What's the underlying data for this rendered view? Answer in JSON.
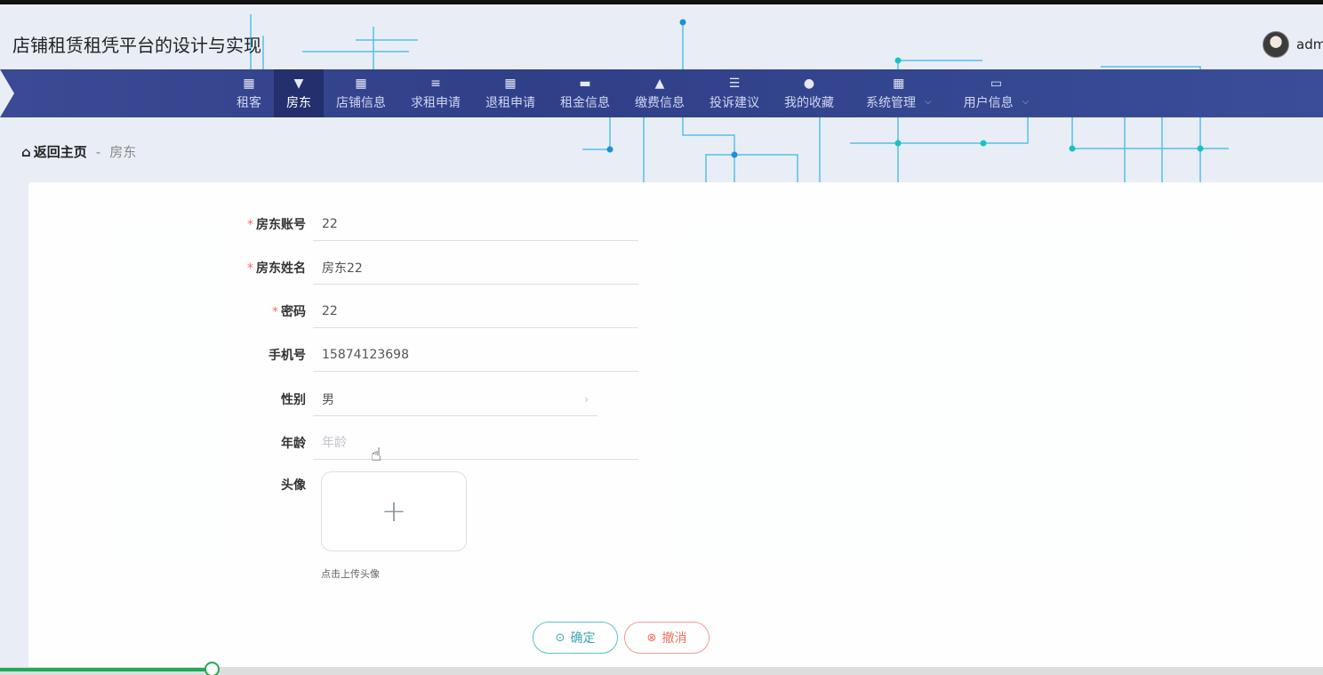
{
  "header": {
    "site_title": "店铺租赁租凭平台的设计与实现",
    "user_name": "adm"
  },
  "nav": {
    "items": [
      {
        "label": "租客",
        "icon": "grid-icon"
      },
      {
        "label": "房东",
        "icon": "brush-icon",
        "active": true
      },
      {
        "label": "店铺信息",
        "icon": "grid-icon"
      },
      {
        "label": "求租申请",
        "icon": "sliders-icon"
      },
      {
        "label": "退租申请",
        "icon": "grid-icon"
      },
      {
        "label": "租金信息",
        "icon": "store-icon"
      },
      {
        "label": "缴费信息",
        "icon": "stamp-icon"
      },
      {
        "label": "投诉建议",
        "icon": "list-icon"
      },
      {
        "label": "我的收藏",
        "icon": "user-icon"
      },
      {
        "label": "系统管理",
        "icon": "grid-icon",
        "dropdown": true
      },
      {
        "label": "用户信息",
        "icon": "card-icon",
        "dropdown": true
      }
    ]
  },
  "breadcrumb": {
    "home": "返回主页",
    "separator": "-",
    "current": "房东"
  },
  "form": {
    "account_label": "房东账号",
    "account_value": "22",
    "name_label": "房东姓名",
    "name_value": "房东22",
    "password_label": "密码",
    "password_value": "22",
    "phone_label": "手机号",
    "phone_value": "15874123698",
    "gender_label": "性别",
    "gender_value": "男",
    "age_label": "年龄",
    "age_placeholder": "年龄",
    "avatar_label": "头像",
    "upload_tip": "点击上传头像",
    "required_mark": "*"
  },
  "buttons": {
    "confirm": "确定",
    "cancel": "撤消"
  },
  "video_progress": {
    "fraction": 0.16
  },
  "colors": {
    "nav_bg": "#2f3f88",
    "nav_active": "#24306d",
    "required": "#f56c6c",
    "confirm": "#3aa6b0",
    "cancel": "#ef6f5e"
  }
}
